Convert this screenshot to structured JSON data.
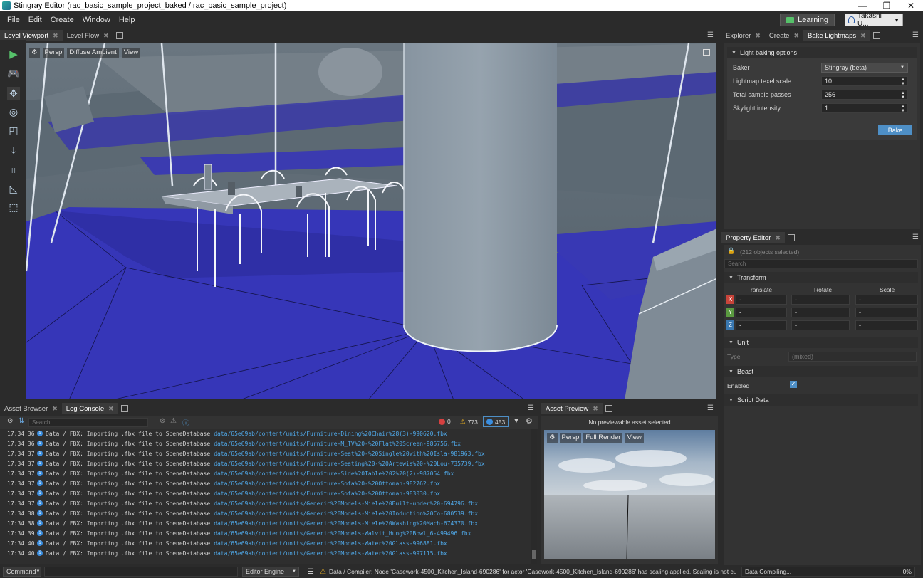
{
  "window": {
    "title": "Stingray Editor (rac_basic_sample_project_baked / rac_basic_sample_project)",
    "minimize": "—",
    "restore": "❐",
    "close": "✕"
  },
  "menu": [
    "File",
    "Edit",
    "Create",
    "Window",
    "Help"
  ],
  "learning_label": "Learning",
  "user_name": "Takashi U...",
  "viewport_tabs": [
    {
      "label": "Level Viewport",
      "active": true
    },
    {
      "label": "Level Flow",
      "active": false
    }
  ],
  "viewport_bar": {
    "gear": "⚙",
    "persp": "Persp",
    "mode": "Diffuse Ambient",
    "view": "View"
  },
  "right_tabs": [
    {
      "label": "Explorer",
      "active": false
    },
    {
      "label": "Create",
      "active": false
    },
    {
      "label": "Bake Lightmaps",
      "active": true
    }
  ],
  "bake": {
    "section": "Light baking options",
    "baker_label": "Baker",
    "baker_value": "Stingray (beta)",
    "texel_label": "Lightmap texel scale",
    "texel_value": "10",
    "passes_label": "Total sample passes",
    "passes_value": "256",
    "skylight_label": "Skylight intensity",
    "skylight_value": "1",
    "bake_button": "Bake"
  },
  "property_editor": {
    "tab": "Property Editor",
    "selection": "(212 objects selected)",
    "search_placeholder": "Search",
    "transform": "Transform",
    "col_translate": "Translate",
    "col_rotate": "Rotate",
    "col_scale": "Scale",
    "axis_x": "X",
    "axis_y": "Y",
    "axis_z": "Z",
    "field_dash": "-",
    "unit": "Unit",
    "type_label": "Type",
    "type_value": "(mixed)",
    "beast": "Beast",
    "enabled_label": "Enabled",
    "script_data": "Script Data"
  },
  "bottom_tabs": [
    {
      "label": "Asset Browser",
      "active": false
    },
    {
      "label": "Log Console",
      "active": true
    }
  ],
  "console": {
    "search_placeholder": "Search",
    "error_count": "0",
    "warning_count": "773",
    "info_count": "453",
    "lines": [
      {
        "time": "17:34:36",
        "msg": "Data / FBX: Importing .fbx file to SceneDatabase",
        "path": "data/65e69ab/content/units/Furniture-Dining%20Chair%28(3)-990620.fbx"
      },
      {
        "time": "17:34:36",
        "msg": "Data / FBX: Importing .fbx file to SceneDatabase",
        "path": "data/65e69ab/content/units/Furniture-M_TV%20-%20Flat%20Screen-985756.fbx"
      },
      {
        "time": "17:34:37",
        "msg": "Data / FBX: Importing .fbx file to SceneDatabase",
        "path": "data/65e69ab/content/units/Furniture-Seat%20-%20Single%20with%20Isla-981963.fbx"
      },
      {
        "time": "17:34:37",
        "msg": "Data / FBX: Importing .fbx file to SceneDatabase",
        "path": "data/65e69ab/content/units/Furniture-Seating%20-%20Artewis%20-%20Lou-735739.fbx"
      },
      {
        "time": "17:34:37",
        "msg": "Data / FBX: Importing .fbx file to SceneDatabase",
        "path": "data/65e69ab/content/units/Furniture-Side%20Table%202%20(2)-987054.fbx"
      },
      {
        "time": "17:34:37",
        "msg": "Data / FBX: Importing .fbx file to SceneDatabase",
        "path": "data/65e69ab/content/units/Furniture-Sofa%20-%20Ottoman-982762.fbx"
      },
      {
        "time": "17:34:37",
        "msg": "Data / FBX: Importing .fbx file to SceneDatabase",
        "path": "data/65e69ab/content/units/Furniture-Sofa%20-%20Ottoman-983030.fbx"
      },
      {
        "time": "17:34:37",
        "msg": "Data / FBX: Importing .fbx file to SceneDatabase",
        "path": "data/65e69ab/content/units/Generic%20Models-Miele%20Built-under%20-694796.fbx"
      },
      {
        "time": "17:34:38",
        "msg": "Data / FBX: Importing .fbx file to SceneDatabase",
        "path": "data/65e69ab/content/units/Generic%20Models-Miele%20Induction%20Co-680539.fbx"
      },
      {
        "time": "17:34:38",
        "msg": "Data / FBX: Importing .fbx file to SceneDatabase",
        "path": "data/65e69ab/content/units/Generic%20Models-Miele%20Washing%20Mach-674370.fbx"
      },
      {
        "time": "17:34:39",
        "msg": "Data / FBX: Importing .fbx file to SceneDatabase",
        "path": "data/65e69ab/content/units/Generic%20Models-Walvit_Hung%20Bowl_6-499496.fbx"
      },
      {
        "time": "17:34:40",
        "msg": "Data / FBX: Importing .fbx file to SceneDatabase",
        "path": "data/65e69ab/content/units/Generic%20Models-Water%20Glass-996881.fbx"
      },
      {
        "time": "17:34:40",
        "msg": "Data / FBX: Importing .fbx file to SceneDatabase",
        "path": "data/65e69ab/content/units/Generic%20Models-Water%20Glass-997115.fbx"
      }
    ]
  },
  "asset_preview": {
    "tab": "Asset Preview",
    "message": "No previewable asset selected",
    "persp": "Persp",
    "mode": "Full Render",
    "view": "View"
  },
  "status": {
    "command": "Command",
    "engine": "Editor Engine",
    "message": "Data / Compiler: Node 'Casework-4500_Kitchen_Island-690286' for actor 'Casework-4500_Kitchen_Island-690286' has scaling applied. Scaling is not currently supported.",
    "progress_label": "Data Compiling...",
    "progress_value": "0%"
  },
  "colors": {
    "accent": "#3aa0d8",
    "bake_button": "#4e8fc6",
    "floor_blue": "#3636b8",
    "link": "#4fa8e8"
  }
}
